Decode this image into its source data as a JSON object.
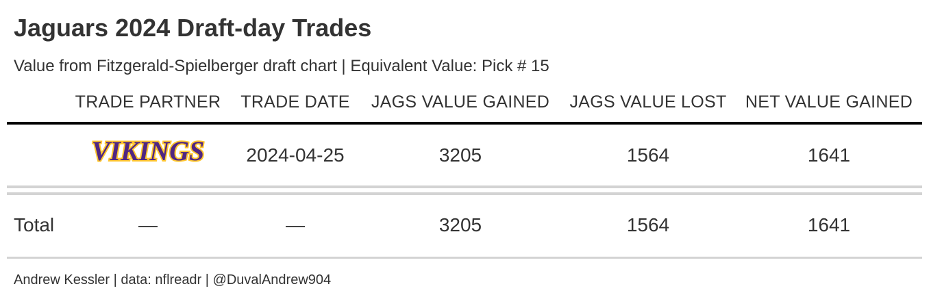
{
  "title": "Jaguars 2024 Draft-day Trades",
  "subtitle": "Value from Fitzgerald-Spielberger draft chart | Equivalent Value: Pick # 15",
  "columns": {
    "partner": "TRADE PARTNER",
    "date": "TRADE DATE",
    "gained": "JAGS VALUE GAINED",
    "lost": "JAGS VALUE LOST",
    "net": "NET VALUE GAINED"
  },
  "rows": [
    {
      "partner_logo": "VIKINGS",
      "date": "2024-04-25",
      "gained": "3205",
      "lost": "1564",
      "net": "1641"
    }
  ],
  "total": {
    "label": "Total",
    "partner": "—",
    "date": "—",
    "gained": "3205",
    "lost": "1564",
    "net": "1641"
  },
  "footer": "Andrew Kessler | data: nflreadr | @DuvalAndrew904",
  "colors": {
    "vikings_purple": "#4f2683",
    "vikings_gold": "#ffc62f"
  }
}
